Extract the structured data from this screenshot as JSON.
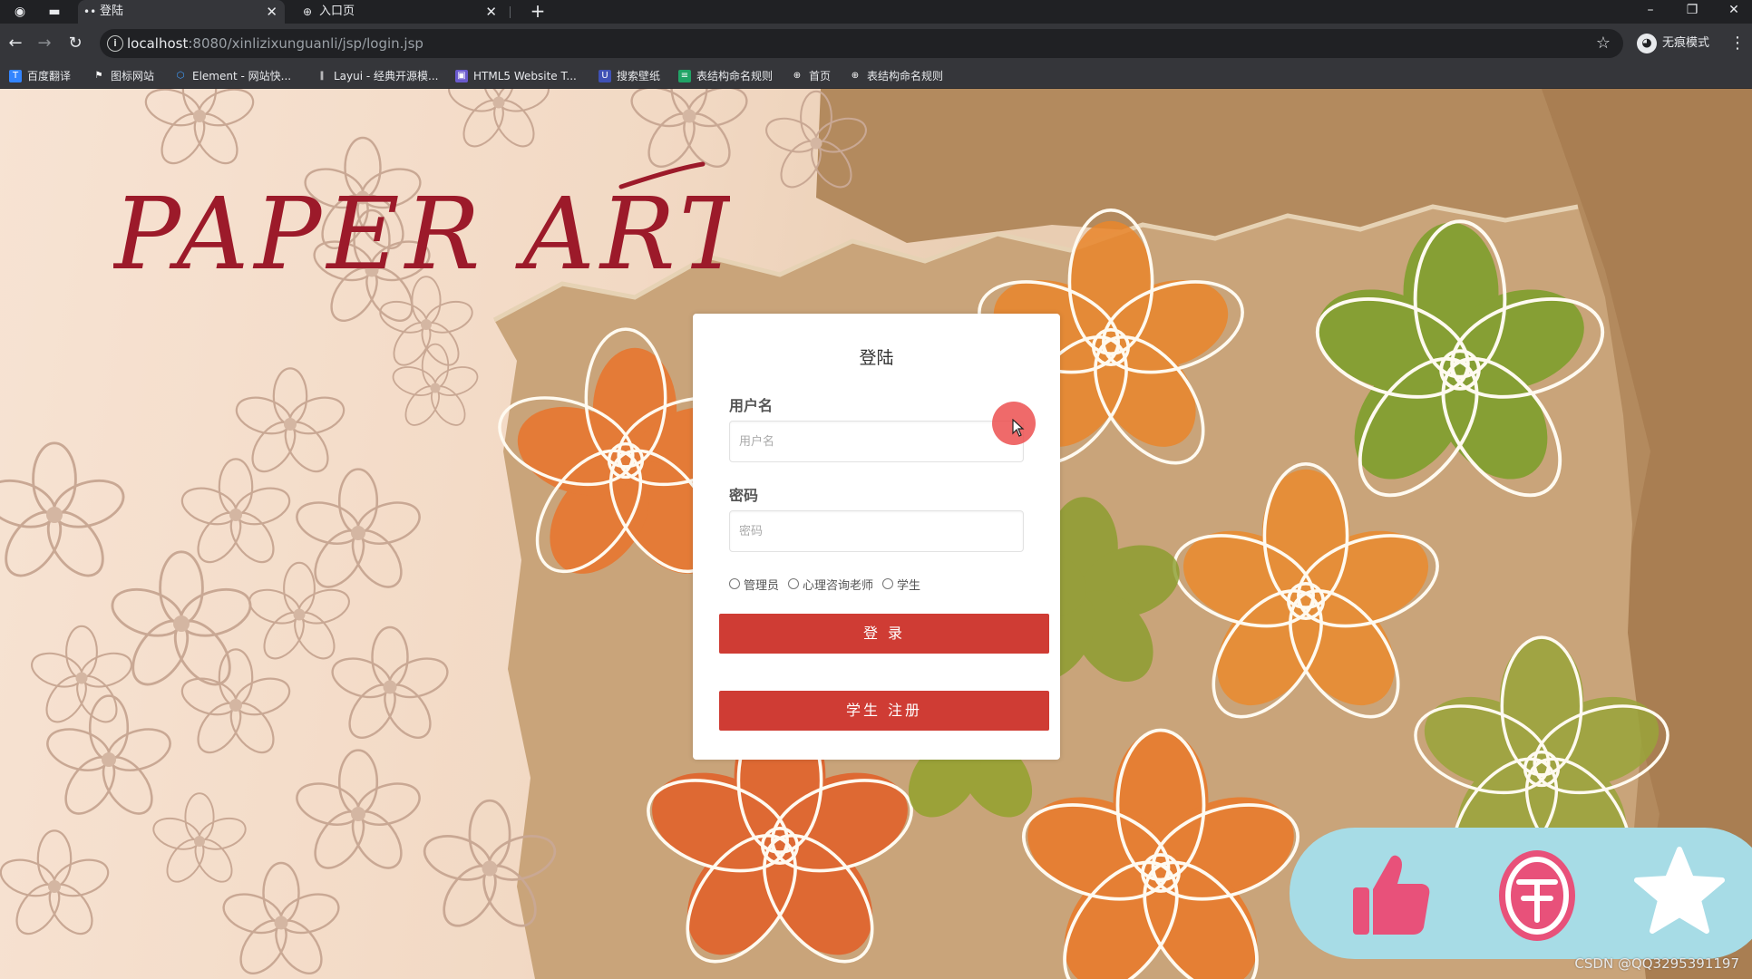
{
  "browser": {
    "tabs": [
      {
        "label": "登陆",
        "active": true
      },
      {
        "label": "入口页",
        "active": false
      }
    ],
    "address_bar": {
      "host": "localhost",
      "rest": ":8080/xinlizixunguanli/jsp/login.jsp"
    },
    "profile_label": "无痕模式",
    "bookmarks": [
      {
        "label": "百度翻译",
        "icon": "baidu-translate-icon",
        "color": "#3385ff"
      },
      {
        "label": "图标网站",
        "icon": "flag-icon",
        "color": "#35363a"
      },
      {
        "label": "Element - 网站快...",
        "icon": "element-icon",
        "color": "#409eff"
      },
      {
        "label": "Layui - 经典开源模...",
        "icon": "layui-icon",
        "color": "#35363a"
      },
      {
        "label": "HTML5 Website T...",
        "icon": "html5-icon",
        "color": "#6a5acd"
      },
      {
        "label": "搜索壁纸",
        "icon": "wallpaper-icon",
        "color": "#3f51b5"
      },
      {
        "label": "表结构命名规则",
        "icon": "doc-icon",
        "color": "#21a366"
      },
      {
        "label": "首页",
        "icon": "globe-icon",
        "color": "#35363a"
      },
      {
        "label": "表结构命名规则",
        "icon": "globe-icon",
        "color": "#35363a"
      }
    ]
  },
  "page": {
    "logo_text": "PAPER ART",
    "login": {
      "title": "登陆",
      "username_label": "用户名",
      "username_placeholder": "用户名",
      "password_label": "密码",
      "password_placeholder": "密码",
      "roles": [
        "管理员",
        "心理咨询老师",
        "学生"
      ],
      "login_button": "登 录",
      "register_button": "学生 注册"
    },
    "accent_color": "#cf3c34"
  },
  "actions": {
    "items": [
      "like-icon",
      "coin-icon",
      "favorite-icon"
    ]
  },
  "watermark": "CSDN @QQ3295391197"
}
